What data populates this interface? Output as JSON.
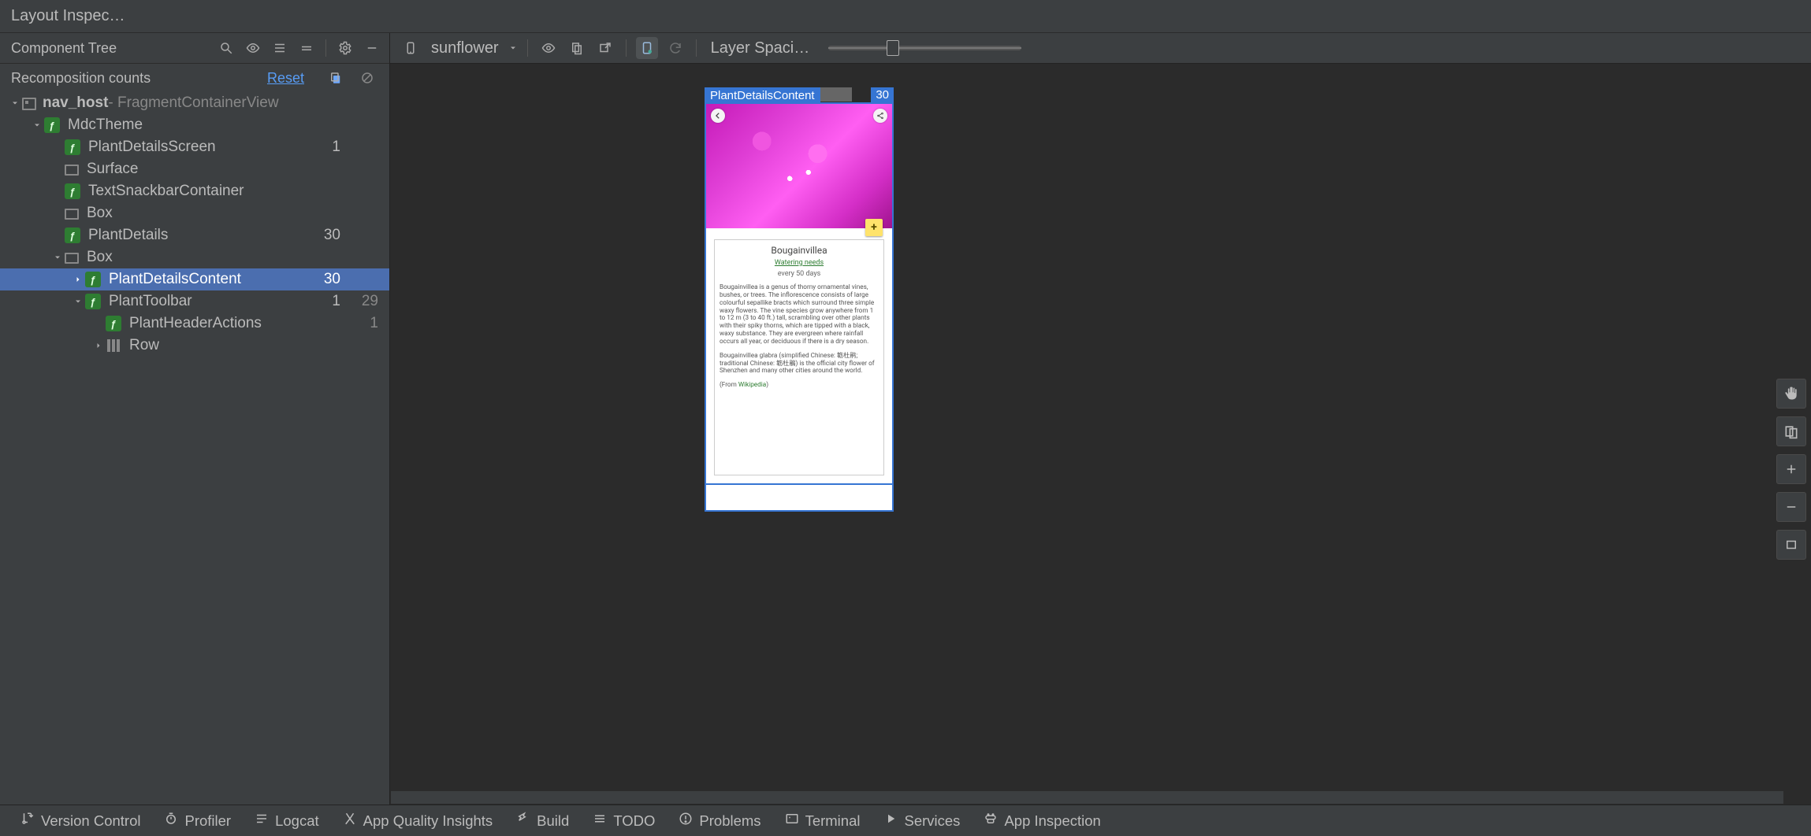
{
  "title": "Layout Inspec…",
  "left_panel": {
    "header": "Component Tree",
    "counts_header": "Recomposition counts",
    "reset_label": "Reset"
  },
  "tree": {
    "root": {
      "name": "nav_host",
      "suffix": " - FragmentContainerView"
    },
    "items": [
      {
        "label": "MdcTheme",
        "kind": "compose",
        "depth": 1,
        "chev": "down"
      },
      {
        "label": "PlantDetailsScreen",
        "kind": "compose",
        "depth": 2,
        "c1": "1"
      },
      {
        "label": "Surface",
        "kind": "view",
        "depth": 2
      },
      {
        "label": "TextSnackbarContainer",
        "kind": "compose",
        "depth": 2
      },
      {
        "label": "Box",
        "kind": "view",
        "depth": 2
      },
      {
        "label": "PlantDetails",
        "kind": "compose",
        "depth": 2,
        "c1": "30"
      },
      {
        "label": "Box",
        "kind": "view",
        "depth": 2,
        "chev": "down"
      },
      {
        "label": "PlantDetailsContent",
        "kind": "compose",
        "depth": 3,
        "chev": "right",
        "selected": true,
        "c1": "30",
        "connector": true
      },
      {
        "label": "PlantToolbar",
        "kind": "compose",
        "depth": 3,
        "chev": "down",
        "c1": "1",
        "c2": "29",
        "connector": true
      },
      {
        "label": "PlantHeaderActions",
        "kind": "compose",
        "depth": 4,
        "c2": "1"
      },
      {
        "label": "Row",
        "kind": "col",
        "depth": 4,
        "chev": "right"
      }
    ]
  },
  "right_panel": {
    "device_label": "sunflower",
    "layer_label": "Layer Spaci…"
  },
  "preview": {
    "sel_label": "PlantDetailsContent",
    "sel_count": "30",
    "plant_title": "Bougainvillea",
    "watering_needs": "Watering needs",
    "watering_freq": "every 50 days",
    "desc1": "Bougainvillea is a genus of thorny ornamental vines, bushes, or trees. The inflorescence consists of large colourful sepallike bracts which surround three simple waxy flowers. The vine species grow anywhere from 1 to 12 m (3 to 40 ft.) tall, scrambling over other plants with their spiky thorns, which are tipped with a black, waxy substance. They are evergreen where rainfall occurs all year, or deciduous if there is a dry season.",
    "desc2": "Bougainvillea glabra (simplified Chinese: 簕杜鹃; traditional Chinese: 簕杜鵑) is the official city flower of Shenzhen and many other cities around the world.",
    "from_label": "(From ",
    "wiki_label": "Wikipedia",
    "from_close": ")"
  },
  "statusbar": {
    "items": [
      "Version Control",
      "Profiler",
      "Logcat",
      "App Quality Insights",
      "Build",
      "TODO",
      "Problems",
      "Terminal",
      "Services",
      "App Inspection"
    ]
  }
}
